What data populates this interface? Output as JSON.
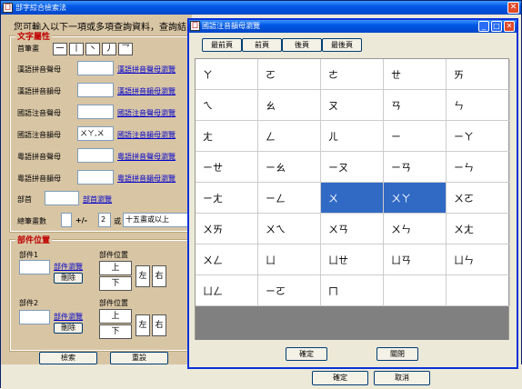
{
  "main": {
    "title": "部字綜合檢索法",
    "intro": "您可輸入以下一項或多項查詢資料，查詢結果",
    "ok_label": "確定",
    "cancel_label": "取消"
  },
  "attr": {
    "title": "文字屬性",
    "first_stroke_label": "首筆畫",
    "strokes": [
      "一",
      "丨",
      "丶",
      "丿",
      "乛"
    ],
    "rows": [
      {
        "label": "漢語拼音聲母",
        "value": "",
        "link": "漢語拼音聲母瀏覽"
      },
      {
        "label": "漢語拼音韻母",
        "value": "",
        "link": "漢語拼音韻母瀏覽"
      },
      {
        "label": "國語注音聲母",
        "value": "",
        "link": "國語注音聲母瀏覽"
      },
      {
        "label": "國語注音韻母",
        "value": "ㄨㄚ,ㄨ",
        "link": "國語注音韻母瀏覽"
      },
      {
        "label": "粵語拼音聲母",
        "value": "",
        "link": "粵語拼音聲母瀏覽"
      },
      {
        "label": "粵語拼音韻母",
        "value": "",
        "link": "粵語拼音韻母瀏覽"
      },
      {
        "label": "部首",
        "value": "",
        "link": "部首瀏覽"
      }
    ],
    "total_strokes_label": "總筆畫數",
    "plusminus": "+/-",
    "range_value": "2",
    "or_label": "或",
    "over15_label": "十五畫或以上"
  },
  "parts": {
    "title": "部件位置",
    "items": [
      {
        "label": "部件1",
        "browse": "部件瀏覽",
        "delete": "刪除",
        "pos_label": "部件位置"
      },
      {
        "label": "部件2",
        "browse": "部件瀏覽",
        "delete": "刪除",
        "pos_label": "部件位置"
      }
    ],
    "pos": {
      "up": "上",
      "down": "下",
      "left": "左",
      "right": "右"
    }
  },
  "actions": {
    "search": "檢索",
    "reset": "重設"
  },
  "dialog": {
    "title": "國語注音韻母瀏覽",
    "nav": [
      "最前頁",
      "前頁",
      "後頁",
      "最後頁"
    ],
    "cells": [
      "ㄚ",
      "ㄛ",
      "ㄜ",
      "ㄝ",
      "ㄞ",
      "ㄟ",
      "ㄠ",
      "ㄡ",
      "ㄢ",
      "ㄣ",
      "ㄤ",
      "ㄥ",
      "ㄦ",
      "ㄧ",
      "ㄧㄚ",
      "ㄧㄝ",
      "ㄧㄠ",
      "ㄧㄡ",
      "ㄧㄢ",
      "ㄧㄣ",
      "ㄧㄤ",
      "ㄧㄥ",
      "ㄨ",
      "ㄨㄚ",
      "ㄨㄛ",
      "ㄨㄞ",
      "ㄨㄟ",
      "ㄨㄢ",
      "ㄨㄣ",
      "ㄨㄤ",
      "ㄨㄥ",
      "ㄩ",
      "ㄩㄝ",
      "ㄩㄢ",
      "ㄩㄣ",
      "ㄩㄥ",
      "ㄧㄛ",
      "ㄇ",
      "",
      ""
    ],
    "selected": [
      "ㄨ",
      "ㄨㄚ"
    ],
    "ok_label": "確定",
    "close_label": "關閉"
  }
}
